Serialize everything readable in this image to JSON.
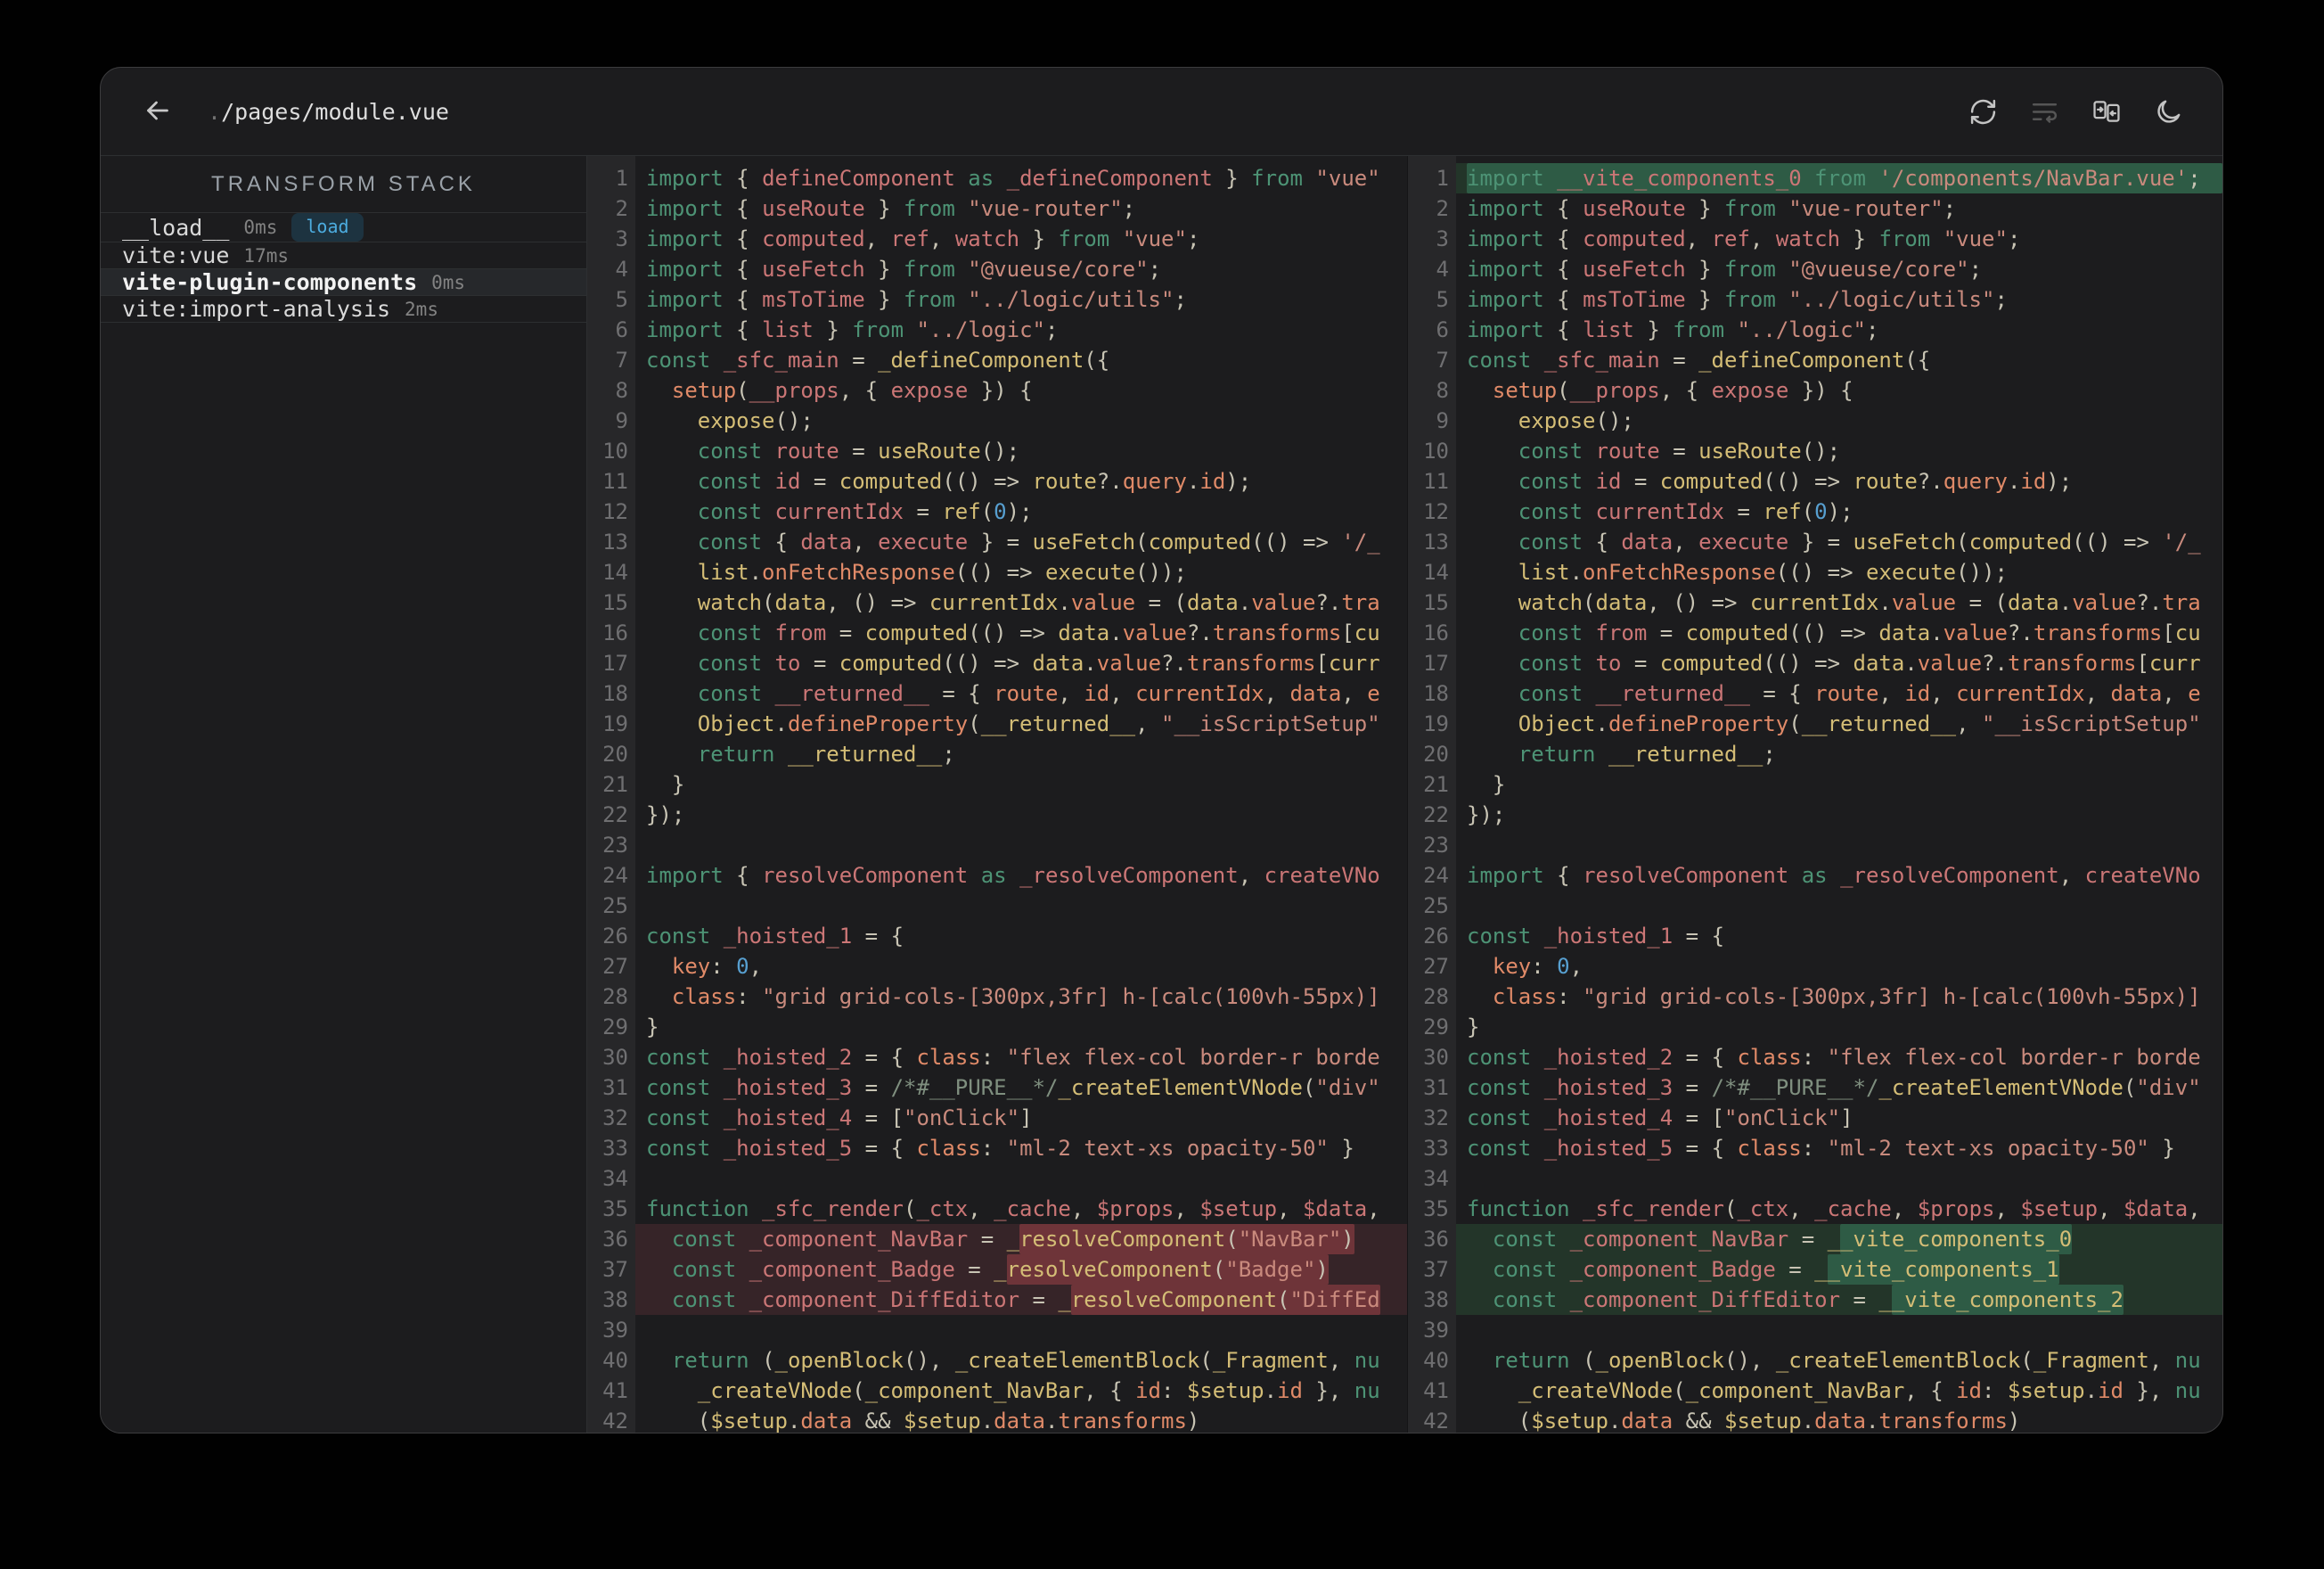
{
  "window": {
    "title_prefix": ".",
    "title_path": "/pages/module.vue"
  },
  "topbar": {
    "icons": [
      {
        "name": "refresh"
      },
      {
        "name": "line-wrap",
        "disabled": true
      },
      {
        "name": "swap-panes"
      },
      {
        "name": "dark-mode"
      }
    ]
  },
  "sidebar": {
    "header": "TRANSFORM STACK",
    "items": [
      {
        "name": "__load__",
        "time": "0ms",
        "badge": "load",
        "selected": false
      },
      {
        "name": "vite:vue",
        "time": "17ms",
        "badge": null,
        "selected": false
      },
      {
        "name": "vite-plugin-components",
        "time": "0ms",
        "badge": null,
        "selected": true
      },
      {
        "name": "vite:import-analysis",
        "time": "2ms",
        "badge": null,
        "selected": false
      }
    ]
  },
  "editor": {
    "left": {
      "lines": [
        "import { defineComponent as _defineComponent } from \"vue\"",
        "import { useRoute } from \"vue-router\";",
        "import { computed, ref, watch } from \"vue\";",
        "import { useFetch } from \"@vueuse/core\";",
        "import { msToTime } from \"../logic/utils\";",
        "import { list } from \"../logic\";",
        "const _sfc_main = _defineComponent({",
        "  setup(__props, { expose }) {",
        "    expose();",
        "    const route = useRoute();",
        "    const id = computed(() => route?.query.id);",
        "    const currentIdx = ref(0);",
        "    const { data, execute } = useFetch(computed(() => '/_",
        "    list.onFetchResponse(() => execute());",
        "    watch(data, () => currentIdx.value = (data.value?.tra",
        "    const from = computed(() => data.value?.transforms[cu",
        "    const to = computed(() => data.value?.transforms[curr",
        "    const __returned__ = { route, id, currentIdx, data, e",
        "    Object.defineProperty(__returned__, \"__isScriptSetup\"",
        "    return __returned__;",
        "  }",
        "});",
        "",
        "import { resolveComponent as _resolveComponent, createVNo",
        "",
        "const _hoisted_1 = {",
        "  key: 0,",
        "  class: \"grid grid-cols-[300px,3fr] h-[calc(100vh-55px)]",
        "}",
        "const _hoisted_2 = { class: \"flex flex-col border-r borde",
        "const _hoisted_3 = /*#__PURE__*/_createElementVNode(\"div\"",
        "const _hoisted_4 = [\"onClick\"]",
        "const _hoisted_5 = { class: \"ml-2 text-xs opacity-50\" }",
        "",
        "function _sfc_render(_ctx, _cache, $props, $setup, $data,",
        "  const _component_NavBar = _resolveComponent(\"NavBar\")",
        "  const _component_Badge = _resolveComponent(\"Badge\")",
        "  const _component_DiffEditor = _resolveComponent(\"DiffEd",
        "",
        "  return (_openBlock(), _createElementBlock(_Fragment, nu",
        "    _createVNode(_component_NavBar, { id: $setup.id }, nu",
        "    ($setup.data && $setup.data.transforms)"
      ],
      "diff": [
        {
          "line": 36,
          "type": "removed",
          "highlight": "resolveComponent(\"NavBar\")"
        },
        {
          "line": 37,
          "type": "removed",
          "highlight": "resolveComponent(\"Badge\")"
        },
        {
          "line": 38,
          "type": "removed",
          "highlight": "resolveComponent(\"DiffEd"
        }
      ]
    },
    "right": {
      "lines": [
        "import __vite_components_0 from '/components/NavBar.vue';",
        "import { useRoute } from \"vue-router\";",
        "import { computed, ref, watch } from \"vue\";",
        "import { useFetch } from \"@vueuse/core\";",
        "import { msToTime } from \"../logic/utils\";",
        "import { list } from \"../logic\";",
        "const _sfc_main = _defineComponent({",
        "  setup(__props, { expose }) {",
        "    expose();",
        "    const route = useRoute();",
        "    const id = computed(() => route?.query.id);",
        "    const currentIdx = ref(0);",
        "    const { data, execute } = useFetch(computed(() => '/_",
        "    list.onFetchResponse(() => execute());",
        "    watch(data, () => currentIdx.value = (data.value?.tra",
        "    const from = computed(() => data.value?.transforms[cu",
        "    const to = computed(() => data.value?.transforms[curr",
        "    const __returned__ = { route, id, currentIdx, data, e",
        "    Object.defineProperty(__returned__, \"__isScriptSetup\"",
        "    return __returned__;",
        "  }",
        "});",
        "",
        "import { resolveComponent as _resolveComponent, createVNo",
        "",
        "const _hoisted_1 = {",
        "  key: 0,",
        "  class: \"grid grid-cols-[300px,3fr] h-[calc(100vh-55px)]",
        "}",
        "const _hoisted_2 = { class: \"flex flex-col border-r borde",
        "const _hoisted_3 = /*#__PURE__*/_createElementVNode(\"div\"",
        "const _hoisted_4 = [\"onClick\"]",
        "const _hoisted_5 = { class: \"ml-2 text-xs opacity-50\" }",
        "",
        "function _sfc_render(_ctx, _cache, $props, $setup, $data,",
        "  const _component_NavBar = __vite_components_0",
        "  const _component_Badge = __vite_components_1",
        "  const _component_DiffEditor = __vite_components_2",
        "",
        "  return (_openBlock(), _createElementBlock(_Fragment, nu",
        "    _createVNode(_component_NavBar, { id: $setup.id }, nu",
        "    ($setup.data && $setup.data.transforms)"
      ],
      "diff": [
        {
          "line": 1,
          "type": "added",
          "highlight": "import __vite_components_0 from '/components/NavBar.vue';"
        },
        {
          "line": 36,
          "type": "added",
          "highlight": "_vite_components_0"
        },
        {
          "line": 37,
          "type": "added",
          "highlight": "_vite_components_1"
        },
        {
          "line": 38,
          "type": "added",
          "highlight": "_vite_components_2"
        }
      ]
    }
  },
  "colors": {
    "accent_badge_fg": "#4cacdf",
    "accent_badge_bg": "#1d3340",
    "diff_removed_bg": "#362428",
    "diff_removed_hl": "#6e3439",
    "diff_added_bg": "#233529",
    "diff_added_hl": "#2e5b45",
    "syntax_keyword": "#4d9375",
    "syntax_definition": "#cb7676",
    "syntax_variable": "#d4bd76",
    "syntax_property": "#e08a68",
    "syntax_string": "#c98a7d",
    "syntax_number": "#579fd0",
    "syntax_comment": "#7f8f7f",
    "syntax_punctuation": "#c8c4b4"
  }
}
